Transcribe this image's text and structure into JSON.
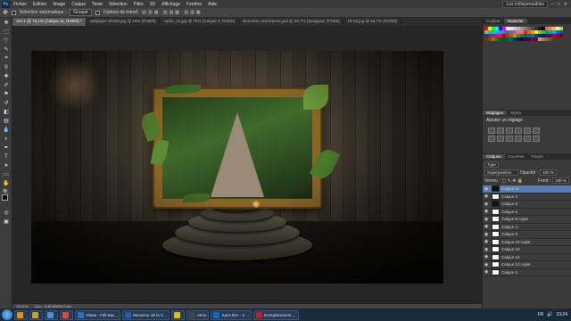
{
  "menubar": {
    "logo": "Ps",
    "items": [
      "Fichier",
      "Edition",
      "Image",
      "Calque",
      "Texte",
      "Sélection",
      "Filtre",
      "3D",
      "Affichage",
      "Fenêtre",
      "Aide"
    ],
    "workspace": "Les indispensables"
  },
  "options": {
    "auto_select_label": "Sélection automatique :",
    "auto_select_value": "Groupe",
    "transform_label": "Options de transf."
  },
  "tabs": [
    {
      "label": "Aro-1 @ 73,1% (Calque 11, RVB/8) *",
      "active": true
    },
    {
      "label": "wallpaper-90400.jpg @ 16% (RVB/8)",
      "active": false
    },
    {
      "label": "cadre_01.jpg @ 75% (Calque 0, RVB/8)",
      "active": false
    },
    {
      "label": "Branches and leaves.psd @ 66,7% (Wrapped, RVB/8)",
      "active": false
    },
    {
      "label": "18-03.jpg @ 66,7% (RVB/8)",
      "active": false
    }
  ],
  "status": {
    "zoom": "73,11%",
    "doc": "Doc : 3,48 Mo/59,2 Mo"
  },
  "swatch_colors": [
    "#ff0000",
    "#ffff00",
    "#00ff00",
    "#00ffff",
    "#0000ff",
    "#ff00ff",
    "#ffffff",
    "#e6e6e6",
    "#cccccc",
    "#b3b3b3",
    "#999999",
    "#808080",
    "#666666",
    "#4d4d4d",
    "#333333",
    "#1a1a1a",
    "#000000",
    "#f26c4f",
    "#f68e55",
    "#fbaf5c",
    "#fff467",
    "#acd372",
    "#7cc576",
    "#3bb878",
    "#1abbb4",
    "#00bff3",
    "#438cca",
    "#5574b9",
    "#605ca8",
    "#855fa8",
    "#a763a8",
    "#f06ea9",
    "#f26d7d",
    "#ed1c24",
    "#f26522",
    "#f7941d",
    "#fff200",
    "#8dc63f",
    "#39b54a",
    "#00a651",
    "#00a99d",
    "#00aeef",
    "#0072bc",
    "#0054a6",
    "#2e3192",
    "#662d91",
    "#92278f",
    "#ec008c",
    "#ed145b",
    "#9e0b0f",
    "#a0410d",
    "#a3620a",
    "#aba000",
    "#598527",
    "#1a7b30",
    "#007236",
    "#00746b",
    "#0076a3",
    "#004a80",
    "#003471",
    "#1b1464",
    "#440e62",
    "#630460",
    "#9e005d",
    "#9e0039",
    "#790000",
    "#7b2e00",
    "#7d4900",
    "#827b00",
    "#406618",
    "#005e20",
    "#005826",
    "#005952",
    "#005b7f",
    "#003663",
    "#002157",
    "#0d004c",
    "#32004b",
    "#4b0049",
    "#7b0046",
    "#7a0026",
    "#c69c6d",
    "#a67c52",
    "#8c6239",
    "#754c24",
    "#603813"
  ],
  "adjustments": {
    "tabs": [
      "Réglages",
      "Styles"
    ],
    "title": "Ajouter un réglage"
  },
  "layers": {
    "tabs": [
      "Calques",
      "Couches",
      "Tracés"
    ],
    "kind_label": "Type",
    "blend_mode": "Superposition",
    "opacity_label": "Opacité :",
    "opacity_value": "100 %",
    "lock_label": "Verrou :",
    "fill_label": "Fond :",
    "fill_value": "100 %",
    "items": [
      {
        "name": "Calque 11",
        "selected": true,
        "dark": true
      },
      {
        "name": "Calque 2",
        "selected": false,
        "dark": false
      },
      {
        "name": "Calque 5",
        "selected": false,
        "dark": true
      },
      {
        "name": "Calque 6",
        "selected": false,
        "dark": false
      },
      {
        "name": "Calque 6 copie",
        "selected": false,
        "dark": false
      },
      {
        "name": "Calque 4",
        "selected": false,
        "dark": false
      },
      {
        "name": "Calque 5",
        "selected": false,
        "dark": false
      },
      {
        "name": "Calque 10 copie",
        "selected": false,
        "dark": false
      },
      {
        "name": "Calque 10",
        "selected": false,
        "dark": false
      },
      {
        "name": "Calque 12",
        "selected": false,
        "dark": false
      },
      {
        "name": "Calque 12 copie",
        "selected": false,
        "dark": false
      },
      {
        "name": "Calque 3",
        "selected": false,
        "dark": false
      }
    ]
  },
  "taskbar": {
    "apps": [
      {
        "label": "",
        "color": "#f08a00"
      },
      {
        "label": "",
        "color": "#c9a227"
      },
      {
        "label": "",
        "color": "#4a90d9"
      },
      {
        "label": "",
        "color": "#e04b2a"
      },
      {
        "label": "Vistas - Fall Bac...",
        "color": "#2e6fbf"
      },
      {
        "label": "Monsieur de la C...",
        "color": "#1f5ea8"
      },
      {
        "label": "",
        "color": "#e0c000"
      },
      {
        "label": "Atmo",
        "color": "#444"
      },
      {
        "label": "Sans titre - 2 ...",
        "color": "#0a6cbf"
      },
      {
        "label": "Enregistrement ...",
        "color": "#c02020"
      }
    ],
    "lang": "FR",
    "clock": "23:24"
  }
}
